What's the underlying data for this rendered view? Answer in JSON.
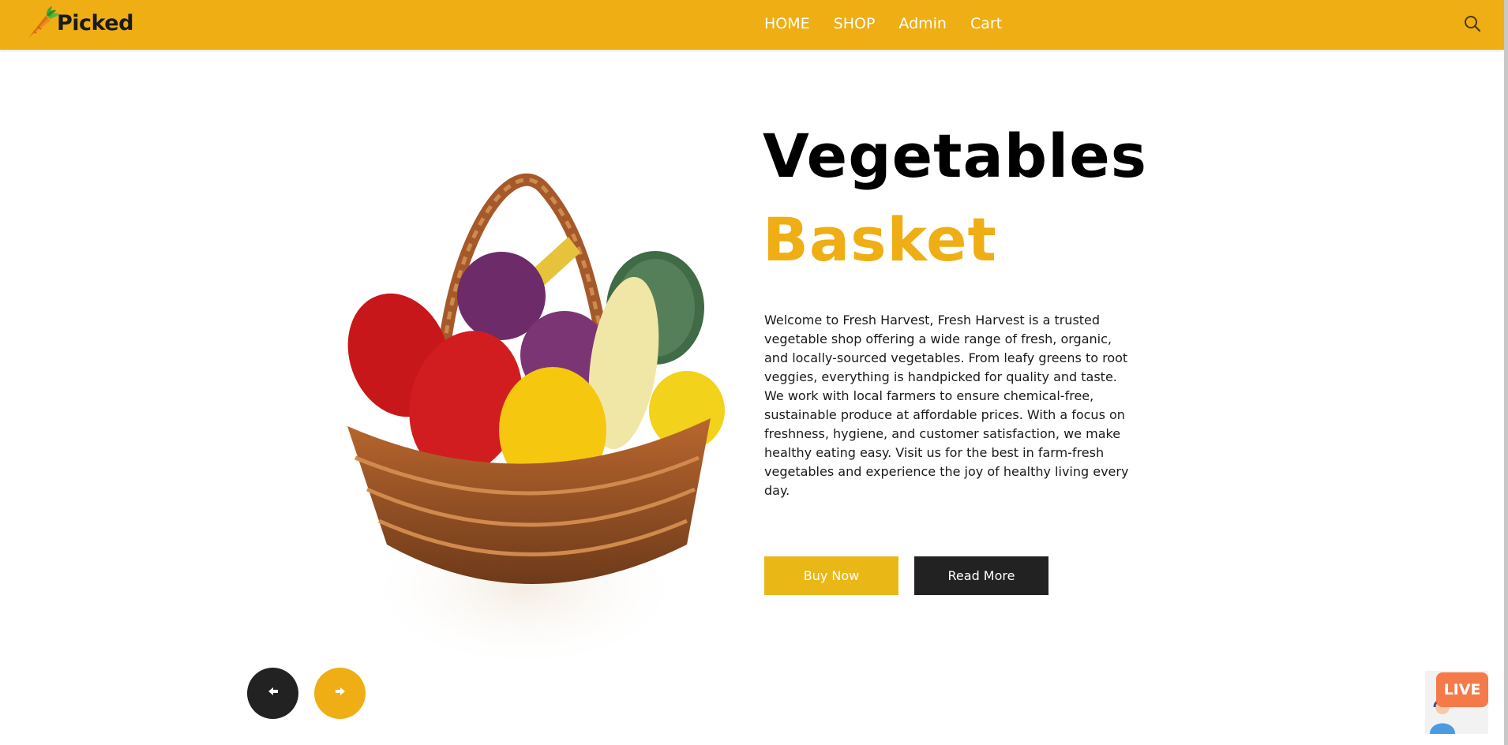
{
  "brand": {
    "name": "Picked",
    "logo_icon": "carrot-icon"
  },
  "nav": {
    "items": [
      {
        "label": "HOME"
      },
      {
        "label": "SHOP"
      },
      {
        "label": "Admin"
      },
      {
        "label": "Cart"
      }
    ],
    "search_icon": "search-icon"
  },
  "hero": {
    "title_line1": "Vegetables",
    "title_line2": "Basket",
    "description": "Welcome to Fresh Harvest, Fresh Harvest is a trusted vegetable shop offering a wide range of fresh, organic, and locally-sourced vegetables. From leafy greens to root veggies, everything is handpicked for quality and taste. We work with local farmers to ensure chemical-free, sustainable produce at affordable prices. With a focus on freshness, hygiene, and customer satisfaction, we make healthy eating easy. Visit us for the best in farm-fresh vegetables and experience the joy of healthy living every day.",
    "buy_label": "Buy Now",
    "read_label": "Read More",
    "image_icon": "vegetable-basket-image"
  },
  "carousel": {
    "prev_icon": "arrow-left-icon",
    "next_icon": "arrow-right-icon"
  },
  "live_chat": {
    "label": "LIVE",
    "icon": "support-agent-icon"
  },
  "colors": {
    "brand_yellow": "#eeae14",
    "button_yellow": "#e9b817",
    "dark": "#222222"
  }
}
